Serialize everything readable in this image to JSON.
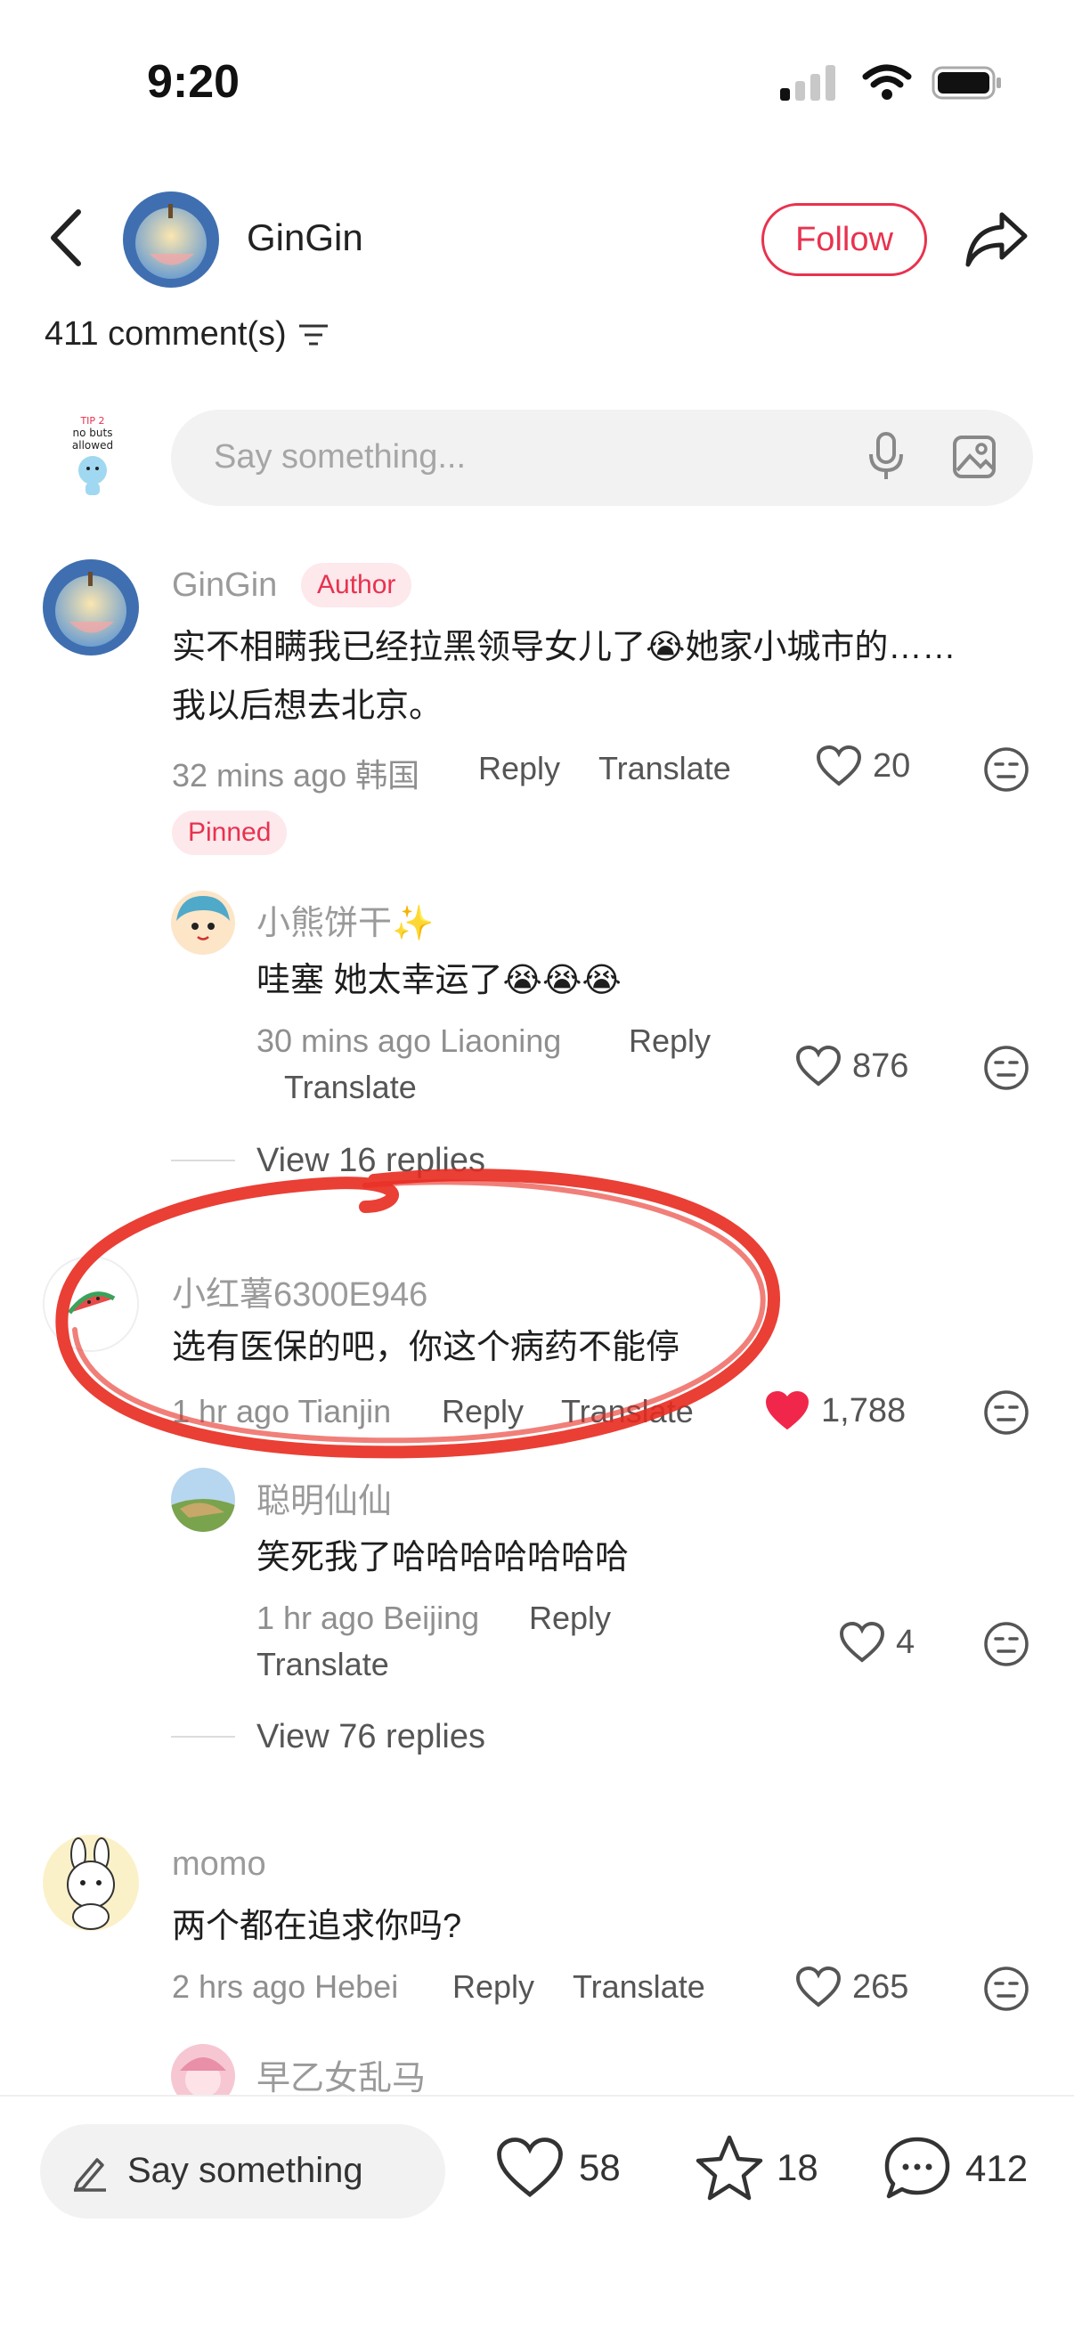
{
  "status": {
    "time": "9:20"
  },
  "header": {
    "username": "GinGin",
    "follow_label": "Follow"
  },
  "comments_header": {
    "count_label": "411 comment(s)"
  },
  "composer": {
    "placeholder": "Say something..."
  },
  "comments": [
    {
      "user": "GinGin",
      "badge": "Author",
      "text_line1": "实不相瞒我已经拉黑领导女儿了😭她家小城市的……",
      "text_line2": "我以后想去北京。",
      "time": "32 mins ago",
      "location": "韩国",
      "reply_label": "Reply",
      "translate_label": "Translate",
      "likes": "20",
      "pinned_label": "Pinned",
      "reply": {
        "user": "小熊饼干✨",
        "text": "哇塞 她太幸运了😭😭😭",
        "time": "30 mins ago",
        "location": "Liaoning",
        "reply_label": "Reply",
        "translate_label": "Translate",
        "likes": "876"
      },
      "view_replies": "View 16 replies"
    },
    {
      "user": "小红薯6300E946",
      "text": "选有医保的吧，你这个病药不能停",
      "time": "1 hr ago",
      "location": "Tianjin",
      "reply_label": "Reply",
      "translate_label": "Translate",
      "likes": "1,788",
      "liked": true,
      "reply": {
        "user": "聪明仙仙",
        "text": "笑死我了哈哈哈哈哈哈哈",
        "time": "1 hr ago",
        "location": "Beijing",
        "reply_label": "Reply",
        "translate_label": "Translate",
        "likes": "4"
      },
      "view_replies": "View 76 replies"
    },
    {
      "user": "momo",
      "text": "两个都在追求你吗?",
      "time": "2 hrs ago",
      "location": "Hebei",
      "reply_label": "Reply",
      "translate_label": "Translate",
      "likes": "265",
      "reply_peek_user": "早乙女乱马"
    }
  ],
  "bottom_bar": {
    "placeholder": "Say something",
    "likes": "58",
    "stars": "18",
    "comments": "412"
  },
  "colors": {
    "accent": "#e8324e",
    "like_red": "#f0274b",
    "highlight_circle": "#e82a1f"
  },
  "icons": [
    "back-icon",
    "share-icon",
    "sort-icon",
    "mic-icon",
    "image-icon",
    "heart-icon",
    "dislike-face-icon",
    "pencil-icon",
    "star-icon",
    "comment-bubble-icon",
    "wifi-icon",
    "battery-icon",
    "signal-icon"
  ]
}
